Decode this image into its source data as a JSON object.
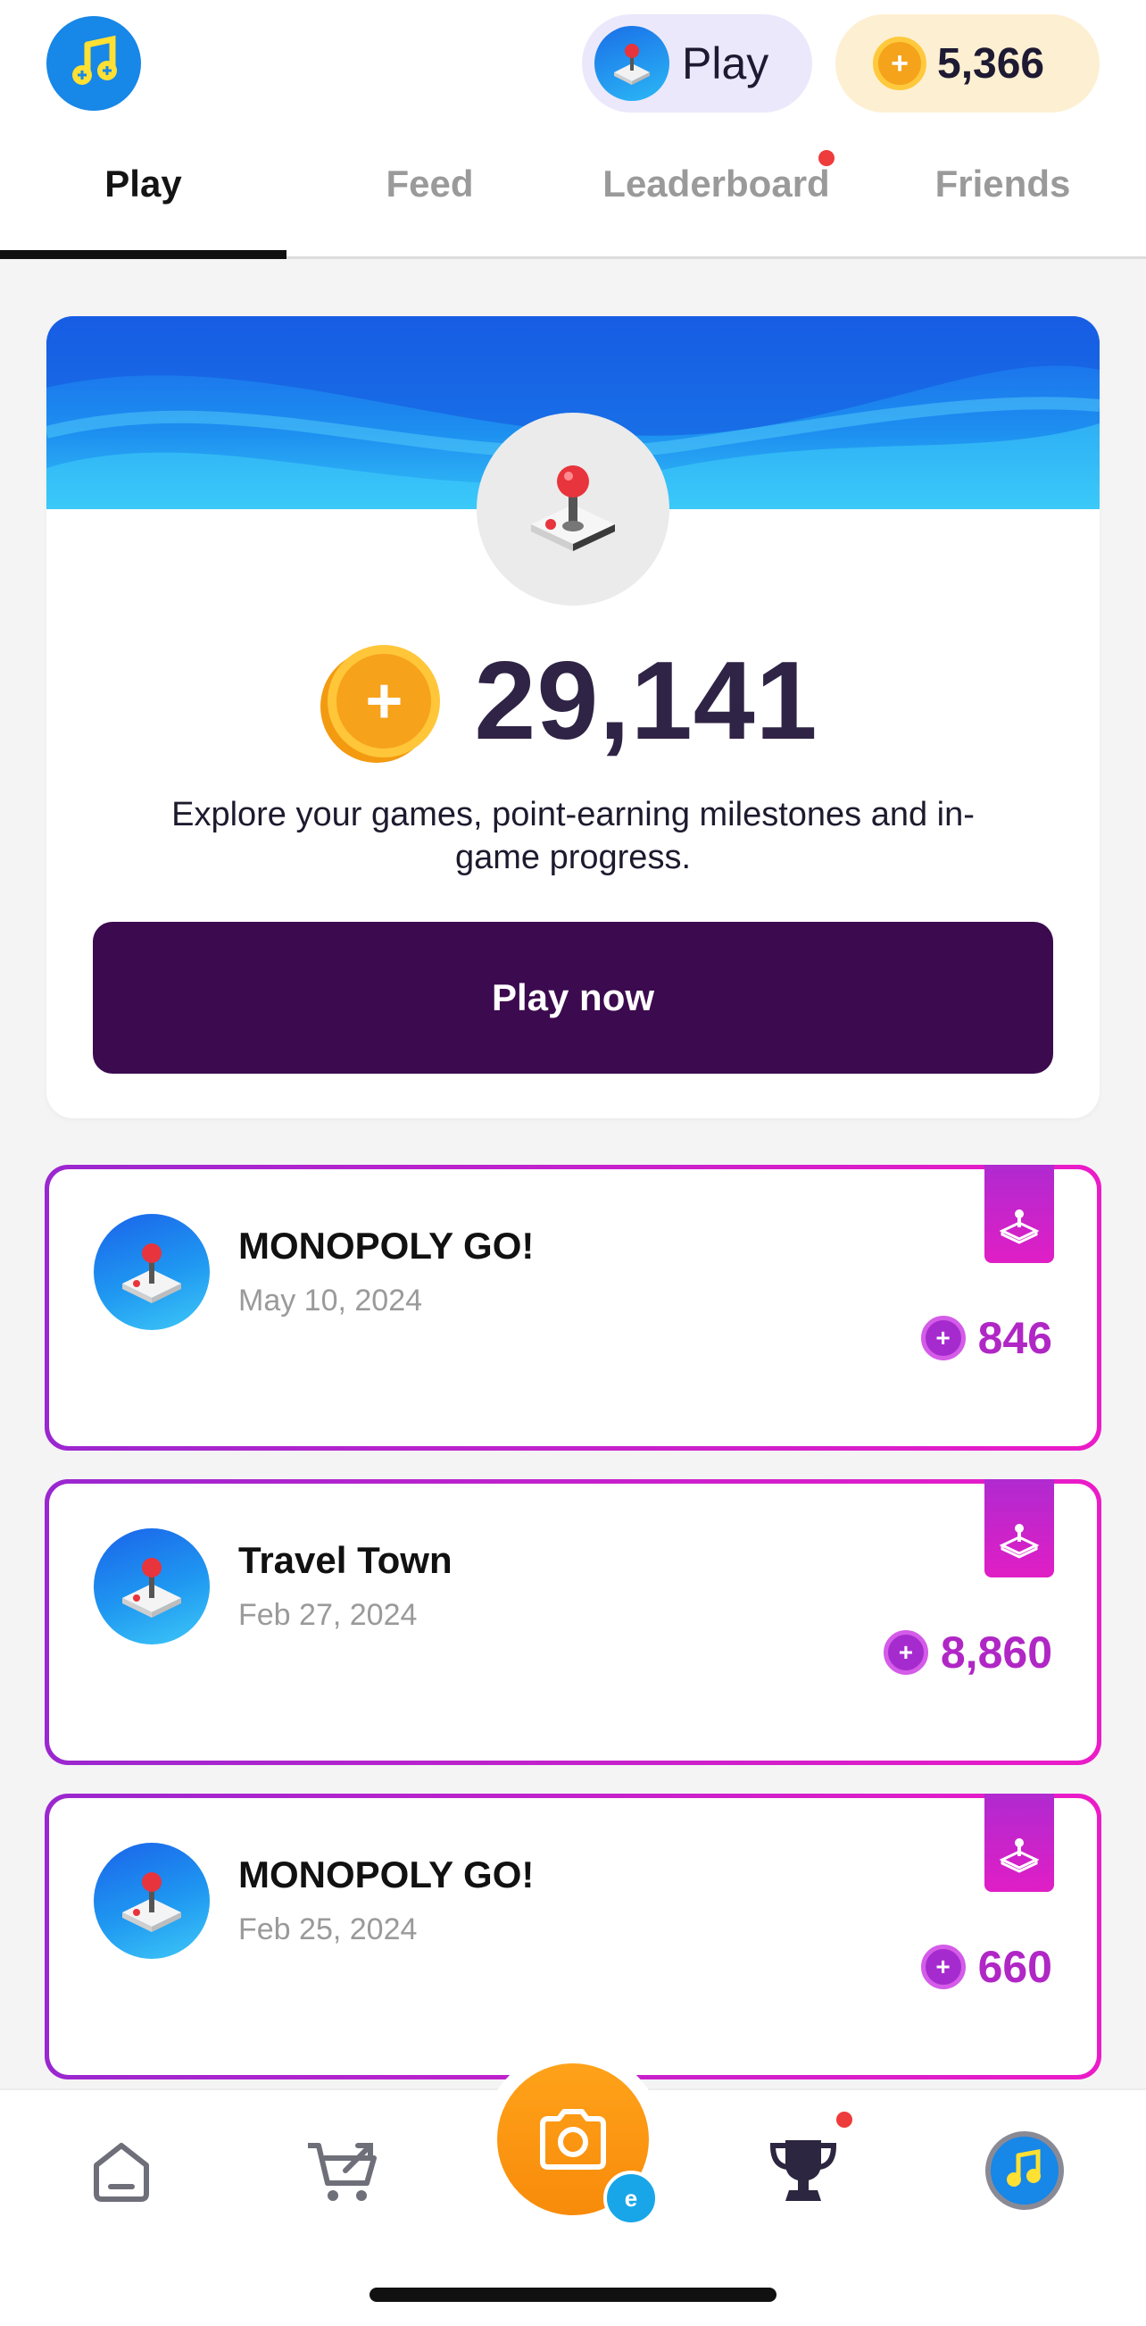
{
  "header": {
    "logo_icon": "music-coin-logo-icon",
    "play_pill": {
      "label": "Play",
      "icon": "joystick-icon"
    },
    "coins_pill": {
      "value": "5,366",
      "icon": "coin-icon"
    }
  },
  "tabs": [
    {
      "label": "Play",
      "active": true
    },
    {
      "label": "Feed",
      "active": false
    },
    {
      "label": "Leaderboard",
      "active": false,
      "notification": true
    },
    {
      "label": "Friends",
      "active": false
    }
  ],
  "hero": {
    "points": "29,141",
    "description": "Explore your games, point-earning milestones and in-game progress.",
    "cta": "Play now"
  },
  "games": [
    {
      "name": "MONOPOLY GO!",
      "date": "May 10, 2024",
      "points": "846"
    },
    {
      "name": "Travel Town",
      "date": "Feb 27, 2024",
      "points": "8,860"
    },
    {
      "name": "MONOPOLY GO!",
      "date": "Feb 25, 2024",
      "points": "660"
    }
  ],
  "bottom_nav": {
    "items": [
      "home-icon",
      "cart-icon",
      "camera-icon",
      "trophy-icon",
      "profile-icon"
    ],
    "receipt_badge": "e"
  },
  "colors": {
    "accent_purple": "#3c0a4f",
    "points_magenta": "#b027c5",
    "coin_orange": "#f7a21b",
    "banner_blue": "#1a63ea"
  }
}
